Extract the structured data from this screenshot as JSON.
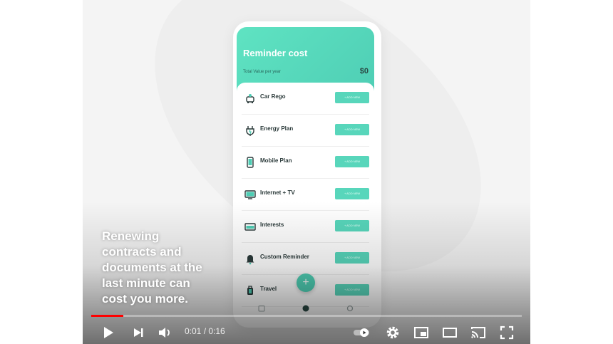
{
  "app": {
    "header": {
      "title": "Reminder cost",
      "subtitle": "Total Value per year",
      "amount": "$0"
    },
    "items": [
      {
        "label": "Car Rego",
        "icon": "car-icon",
        "button": "+ ADD NEW"
      },
      {
        "label": "Energy Plan",
        "icon": "plug-icon",
        "button": "+ ADD NEW"
      },
      {
        "label": "Mobile Plan",
        "icon": "mobile-icon",
        "button": "+ ADD NEW"
      },
      {
        "label": "Internet + TV",
        "icon": "tv-icon",
        "button": "+ ADD NEW"
      },
      {
        "label": "Interests",
        "icon": "card-icon",
        "button": "+ ADD NEW"
      },
      {
        "label": "Custom Reminder",
        "icon": "bell-icon",
        "button": "+ ADD NEW"
      },
      {
        "label": "Travel",
        "icon": "luggage-icon",
        "button": "+ ADD NEW"
      }
    ],
    "fab": "+"
  },
  "caption": "Renewing contracts and documents at the last minute can cost you more.",
  "player": {
    "current_time": "0:01",
    "duration": "0:16",
    "time_display": "0:01 / 0:16",
    "progress": 0.074
  },
  "colors": {
    "accent": "#58d6bb",
    "progress": "#ff0000"
  }
}
